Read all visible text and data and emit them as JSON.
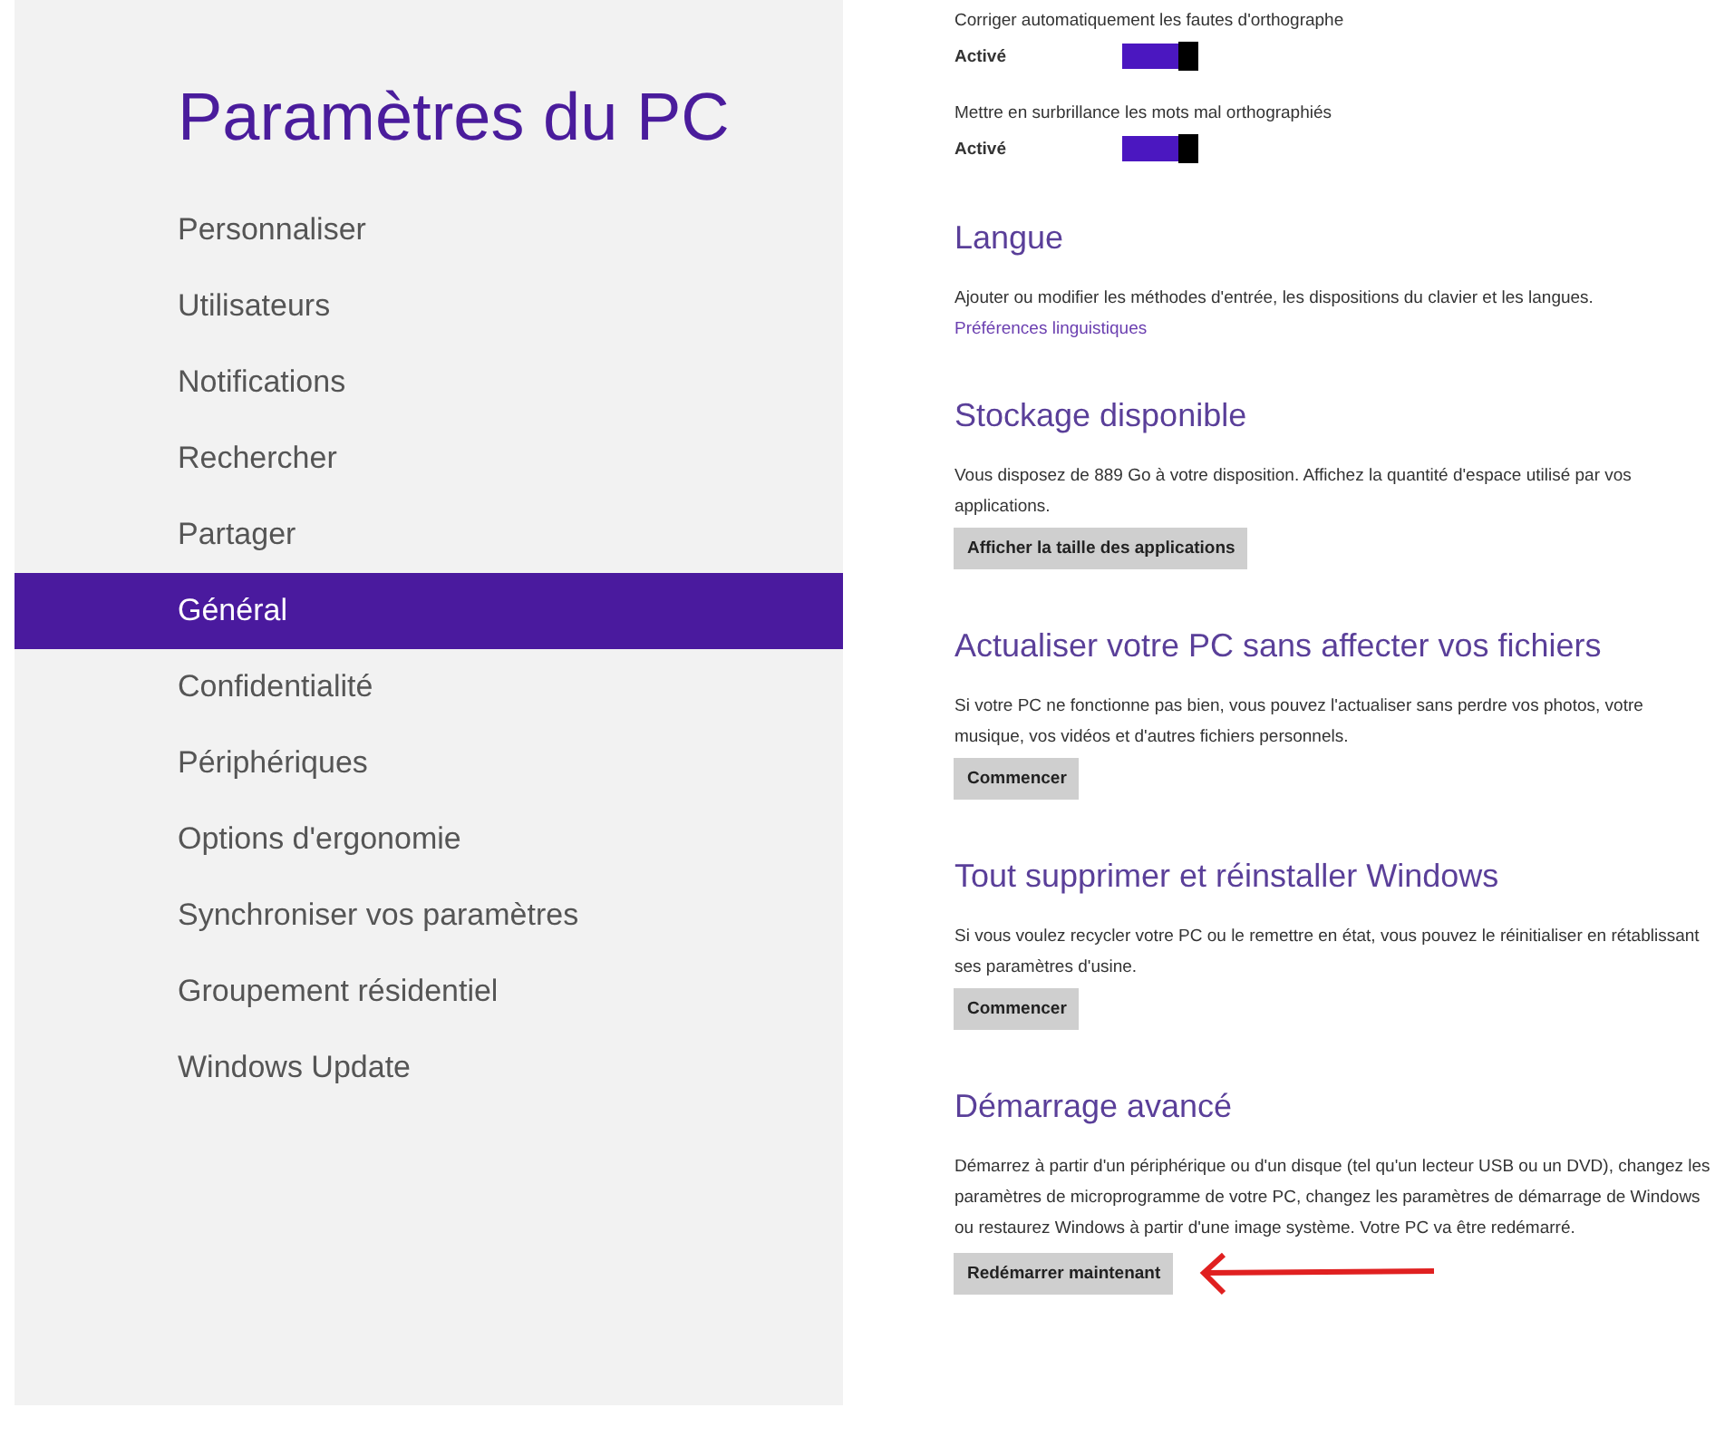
{
  "sidebar": {
    "title": "Paramètres du PC",
    "items": [
      {
        "label": "Personnaliser",
        "selected": false
      },
      {
        "label": "Utilisateurs",
        "selected": false
      },
      {
        "label": "Notifications",
        "selected": false
      },
      {
        "label": "Rechercher",
        "selected": false
      },
      {
        "label": "Partager",
        "selected": false
      },
      {
        "label": "Général",
        "selected": true
      },
      {
        "label": "Confidentialité",
        "selected": false
      },
      {
        "label": "Périphériques",
        "selected": false
      },
      {
        "label": "Options d'ergonomie",
        "selected": false
      },
      {
        "label": "Synchroniser vos paramètres",
        "selected": false
      },
      {
        "label": "Groupement résidentiel",
        "selected": false
      },
      {
        "label": "Windows Update",
        "selected": false
      }
    ]
  },
  "toggles": [
    {
      "label": "Corriger automatiquement les fautes d'orthographe",
      "state": "Activé",
      "on": true
    },
    {
      "label": "Mettre en surbrillance les mots mal orthographiés",
      "state": "Activé",
      "on": true
    }
  ],
  "sections": [
    {
      "heading": "Langue",
      "text": "Ajouter ou modifier les méthodes d'entrée, les dispositions du clavier et les langues.",
      "link": "Préférences linguistiques"
    },
    {
      "heading": "Stockage disponible",
      "text": "Vous disposez de 889 Go à votre disposition. Affichez la quantité d'espace utilisé par vos applications.",
      "button": {
        "label": "Afficher la taille des applications",
        "pointed": false
      }
    },
    {
      "heading": "Actualiser votre PC sans affecter vos fichiers",
      "text": "Si votre PC ne fonctionne pas bien, vous pouvez l'actualiser sans perdre vos photos, votre musique, vos vidéos et d'autres fichiers personnels.",
      "button": {
        "label": "Commencer",
        "pointed": false
      }
    },
    {
      "heading": "Tout supprimer et réinstaller Windows",
      "text": "Si vous voulez recycler votre PC ou le remettre en état, vous pouvez le réinitialiser en rétablissant ses paramètres d'usine.",
      "button": {
        "label": "Commencer",
        "pointed": false
      }
    },
    {
      "heading": "Démarrage avancé",
      "text": "Démarrez à partir d'un périphérique ou d'un disque (tel qu'un lecteur USB ou un DVD), changez les paramètres de microprogramme de votre PC, changez les paramètres de démarrage de Windows ou restaurez Windows à partir d'une image système. Votre PC va être redémarré.",
      "button": {
        "label": "Redémarrer maintenant",
        "pointed": true
      }
    }
  ]
}
